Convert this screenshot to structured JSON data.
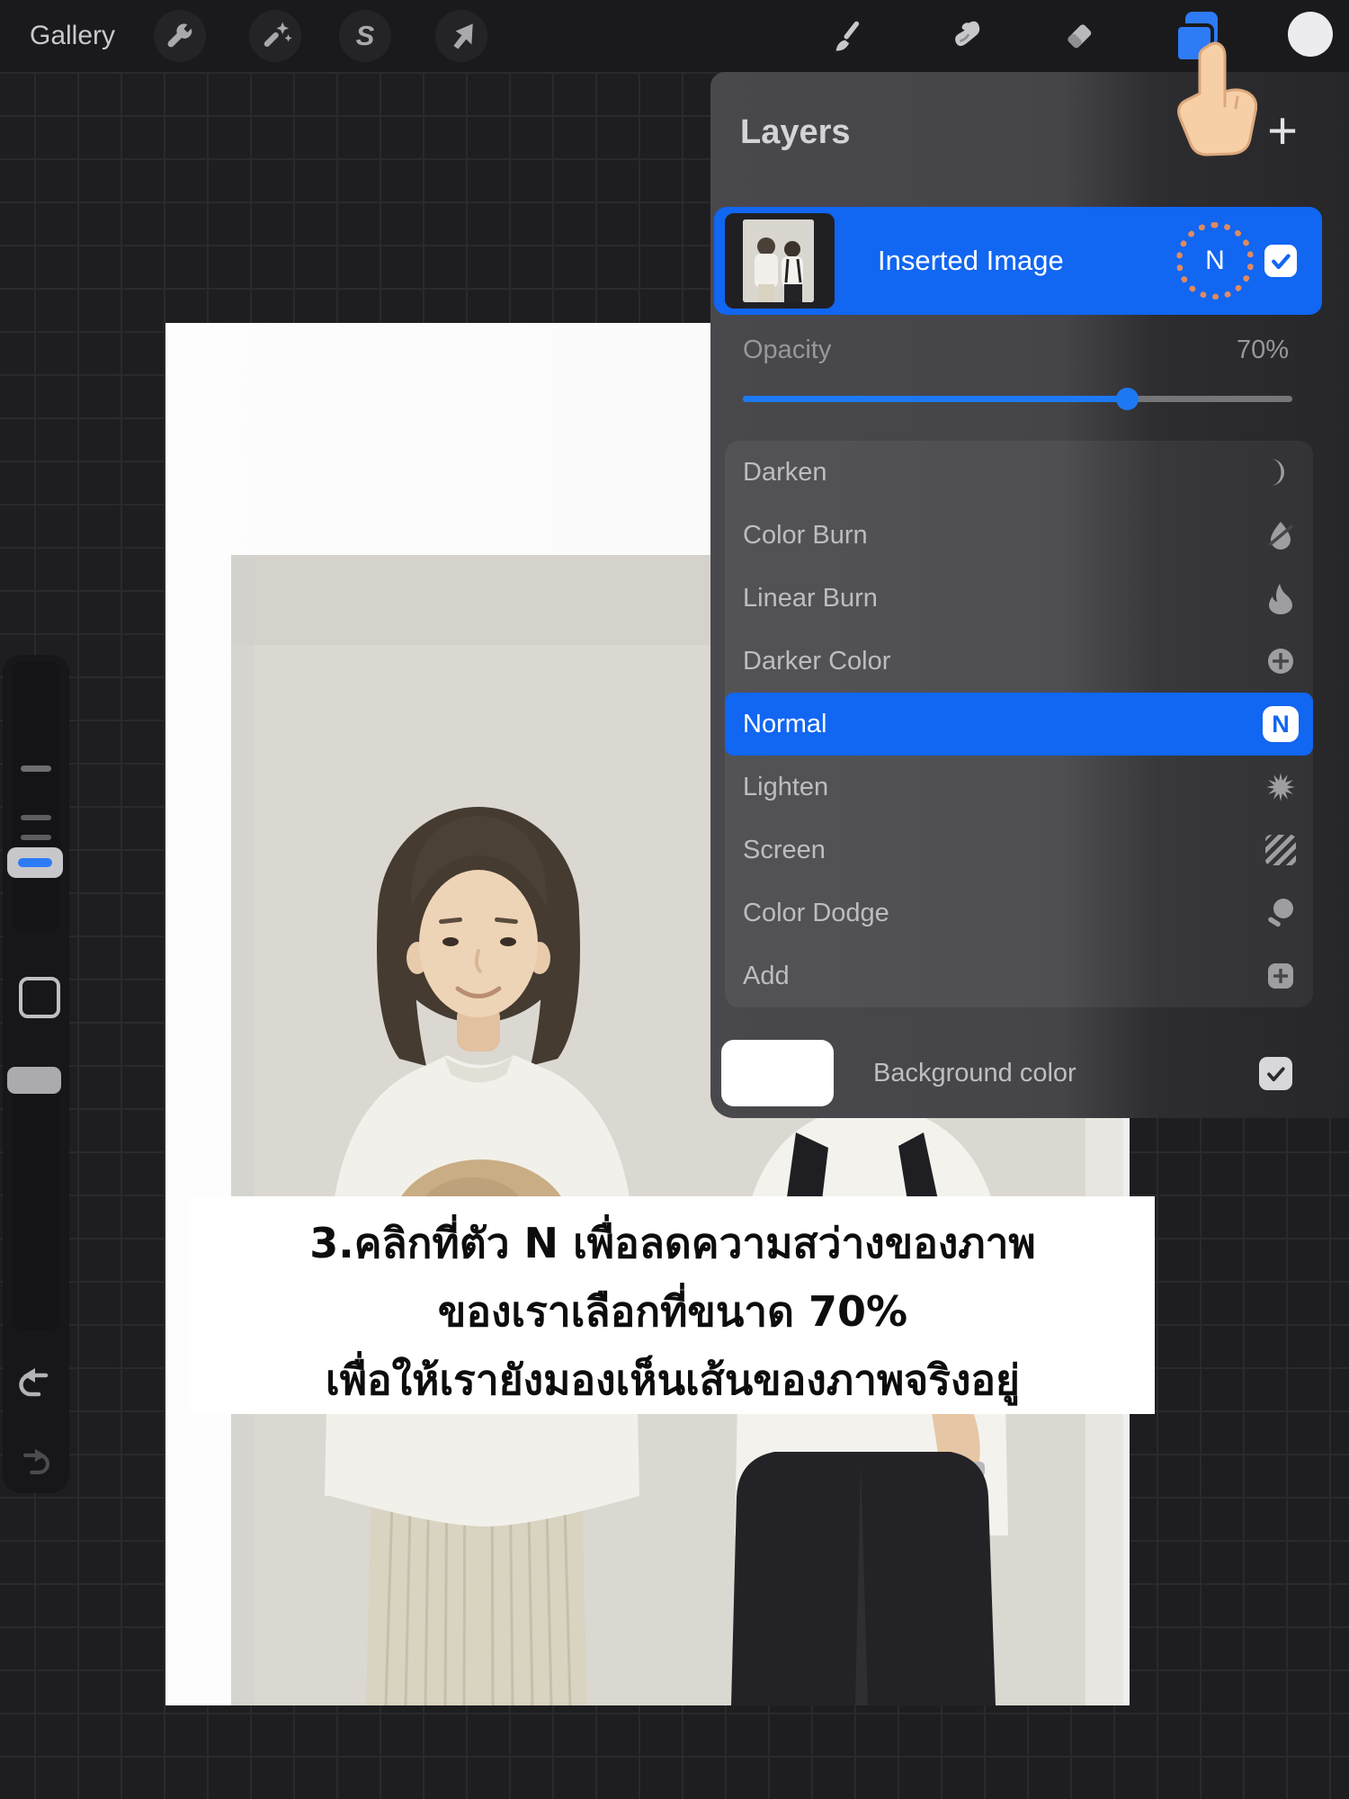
{
  "topbar": {
    "gallery_label": "Gallery",
    "selection_icon_letter": "S",
    "left_tool_icons": [
      "wrench-icon",
      "magic-wand-icon",
      "selection-icon",
      "transform-arrow-icon"
    ],
    "right_tool_icons": [
      "brush-icon",
      "smudge-icon",
      "eraser-icon",
      "layers-icon",
      "color-swatch"
    ]
  },
  "pointer": {
    "icon": "pointing-finger"
  },
  "layers_panel": {
    "title": "Layers",
    "add_button": "+",
    "layer": {
      "name": "Inserted Image",
      "blend_badge": "N",
      "visible_checked": true
    },
    "opacity": {
      "label": "Opacity",
      "value": "70%",
      "percent": 70
    },
    "blend_modes": [
      {
        "label": "Darken",
        "icon": "moon-icon"
      },
      {
        "label": "Color Burn",
        "icon": "droplet-slash-icon"
      },
      {
        "label": "Linear Burn",
        "icon": "flame-icon"
      },
      {
        "label": "Darker Color",
        "icon": "circle-plus-icon"
      },
      {
        "label": "Normal",
        "icon": "n-badge-icon",
        "badge": "N",
        "selected": true
      },
      {
        "label": "Lighten",
        "icon": "starburst-icon"
      },
      {
        "label": "Screen",
        "icon": "hatch-icon"
      },
      {
        "label": "Color Dodge",
        "icon": "dodge-icon"
      },
      {
        "label": "Add",
        "icon": "square-plus-icon"
      }
    ],
    "background_row": {
      "label": "Background color",
      "swatch_color": "#ffffff",
      "checked": true
    }
  },
  "caption": {
    "lines": [
      "3.คลิกที่ตัว N เพื่อลดความสว่างของภาพ",
      "ของเราเลือกที่ขนาด 70%",
      "เพื่อให้เรายังมองเห็นเส้นของภาพจริงอยู่"
    ]
  },
  "colors": {
    "accent_blue": "#1166f2",
    "selection_blue": "#2e7bf6",
    "dot_orange": "#e08a60",
    "panel_light": "#47474b",
    "panel_dark": "#27272a",
    "background_swatch": "#ffffff"
  }
}
